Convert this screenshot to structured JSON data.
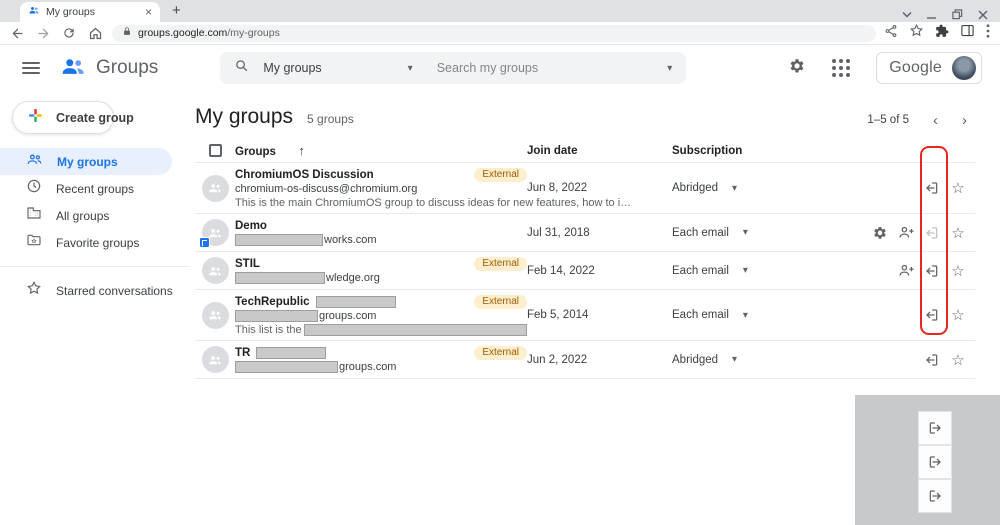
{
  "browser": {
    "tab_title": "My groups",
    "url_domain": "groups.google.com",
    "url_path": "/my-groups"
  },
  "header": {
    "app_name": "Groups",
    "search_scope": "My groups",
    "search_placeholder": "Search my groups",
    "logo_text": "Google"
  },
  "sidebar": {
    "create_label": "Create group",
    "items": [
      {
        "label": "My groups",
        "icon": "groups-icon",
        "selected": true
      },
      {
        "label": "Recent groups",
        "icon": "clock-icon",
        "selected": false
      },
      {
        "label": "All groups",
        "icon": "domain-icon",
        "selected": false
      },
      {
        "label": "Favorite groups",
        "icon": "folder-icon",
        "selected": false
      }
    ],
    "starred_label": "Starred conversations"
  },
  "main": {
    "title": "My groups",
    "count_label": "5 groups",
    "pagination": "1–5 of 5",
    "columns": {
      "groups": "Groups",
      "join_date": "Join date",
      "subscription": "Subscription"
    },
    "external_label": "External",
    "rows": [
      {
        "name": "ChromiumOS Discussion",
        "email": "chromium-os-discuss@chromium.org",
        "desc": "This is the main ChromiumOS group to discuss ideas for new features, how to i…",
        "external": true,
        "join_date": "Jun 8, 2022",
        "subscription": "Abridged",
        "gear": false,
        "person_add": false,
        "leave_dim": false,
        "org_badge": false,
        "name_redact": 0,
        "email_redact": 0,
        "desc_redact": 0
      },
      {
        "name": "Demo",
        "email": "works.com",
        "desc": "",
        "external": false,
        "join_date": "Jul 31, 2018",
        "subscription": "Each email",
        "gear": true,
        "person_add": true,
        "leave_dim": true,
        "org_badge": true,
        "name_redact": 0,
        "email_redact": 88,
        "desc_redact": 0
      },
      {
        "name": "STIL",
        "email": "wledge.org",
        "desc": "",
        "external": true,
        "join_date": "Feb 14, 2022",
        "subscription": "Each email",
        "gear": false,
        "person_add": true,
        "leave_dim": false,
        "org_badge": false,
        "name_redact": 0,
        "email_redact": 90,
        "desc_redact": 0
      },
      {
        "name": "TechRepublic",
        "email": "groups.com",
        "desc": "This list is the",
        "external": true,
        "join_date": "Feb 5, 2014",
        "subscription": "Each email",
        "gear": false,
        "person_add": false,
        "leave_dim": false,
        "org_badge": false,
        "name_redact": 80,
        "email_redact": 83,
        "desc_redact": 250
      },
      {
        "name": "TR",
        "email": "groups.com",
        "desc": "",
        "external": true,
        "join_date": "Jun 2, 2022",
        "subscription": "Abridged",
        "gear": false,
        "person_add": false,
        "leave_dim": false,
        "org_badge": false,
        "name_redact": 70,
        "email_redact": 103,
        "desc_redact": 0
      }
    ]
  },
  "colors": {
    "accent_blue": "#1a73e8",
    "selected_bg": "#e8f0fe",
    "badge_bg": "#fdeecd",
    "badge_text": "#a05c00",
    "highlight_red": "#e8261f"
  },
  "overlay": {
    "icon": "sign-out-icon",
    "cell_count": 3
  }
}
